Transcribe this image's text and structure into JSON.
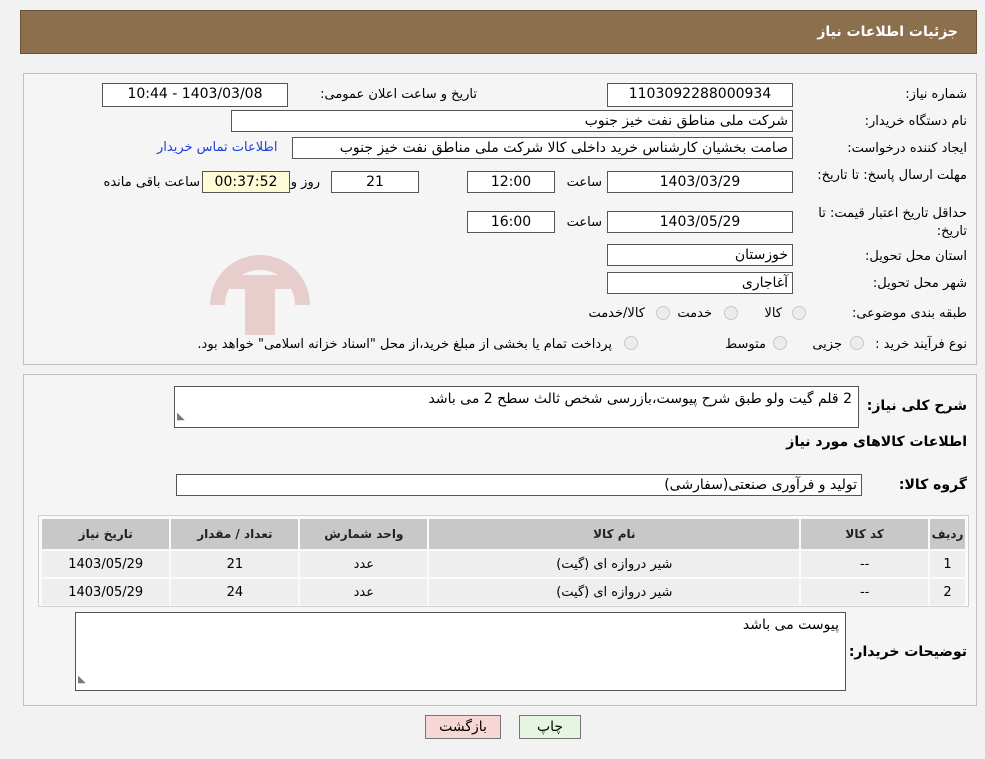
{
  "header": {
    "title": "جزئیات اطلاعات نیاز"
  },
  "fields": {
    "need_number_label": "شماره نیاز:",
    "need_number": "1103092288000934",
    "announce_label": "تاریخ و ساعت اعلان عمومی:",
    "announce_value": "1403/03/08 - 10:44",
    "buyer_org_label": "نام دستگاه خریدار:",
    "buyer_org": "شرکت ملی مناطق نفت خیز جنوب",
    "creator_label": "ایجاد کننده درخواست:",
    "creator": "صامت  بخشیان  کارشناس خرید داخلی کالا  شرکت ملی مناطق نفت خیز جنوب",
    "contact_link": "اطلاعات تماس خریدار",
    "deadline_label": "مهلت ارسال پاسخ: تا تاریخ:",
    "deadline_date": "1403/03/29",
    "time_label": "ساعت",
    "deadline_time": "12:00",
    "days_value": "21",
    "days_label": "روز و",
    "remaining_time": "00:37:52",
    "remaining_label": "ساعت باقی مانده",
    "validity_label": "حداقل تاریخ اعتبار قیمت: تا تاریخ:",
    "validity_date": "1403/05/29",
    "validity_time": "16:00",
    "province_label": "استان محل تحویل:",
    "province": "خوزستان",
    "city_label": "شهر محل تحویل:",
    "city": "آغاجاری",
    "category_label": "طبقه بندی موضوعی:",
    "category_options": [
      "کالا",
      "خدمت",
      "کالا/خدمت"
    ],
    "process_label": "نوع فرآیند خرید :",
    "process_options": [
      "جزیی",
      "متوسط"
    ],
    "process_note": "پرداخت تمام یا بخشی از مبلغ خرید،از محل \"اسناد خزانه اسلامی\" خواهد بود."
  },
  "summary": {
    "label": "شرح کلی نیاز:",
    "text": "2 قلم گیت ولو طبق شرح پیوست،بازرسی شخص ثالث سطح 2 می باشد",
    "items_title": "اطلاعات کالاهای مورد نیاز",
    "group_label": "گروه کالا:",
    "group_value": "تولید و فرآوری صنعتی(سفارشی)"
  },
  "table": {
    "headers": [
      "ردیف",
      "کد کالا",
      "نام کالا",
      "واحد شمارش",
      "تعداد / مقدار",
      "تاریخ نیاز"
    ],
    "rows": [
      [
        "1",
        "--",
        "شیر دروازه ای (گیت)",
        "عدد",
        "21",
        "1403/05/29"
      ],
      [
        "2",
        "--",
        "شیر دروازه ای (گیت)",
        "عدد",
        "24",
        "1403/05/29"
      ]
    ]
  },
  "notes": {
    "label": "توضیحات خریدار:",
    "text": "پیوست می باشد"
  },
  "buttons": {
    "print": "چاپ",
    "back": "بازگشت"
  },
  "colors": {
    "header_bg": "#8c6f4c",
    "back_btn": "#f7d6d6",
    "print_btn": "#e6f5e0",
    "link": "#1f3fd6"
  }
}
